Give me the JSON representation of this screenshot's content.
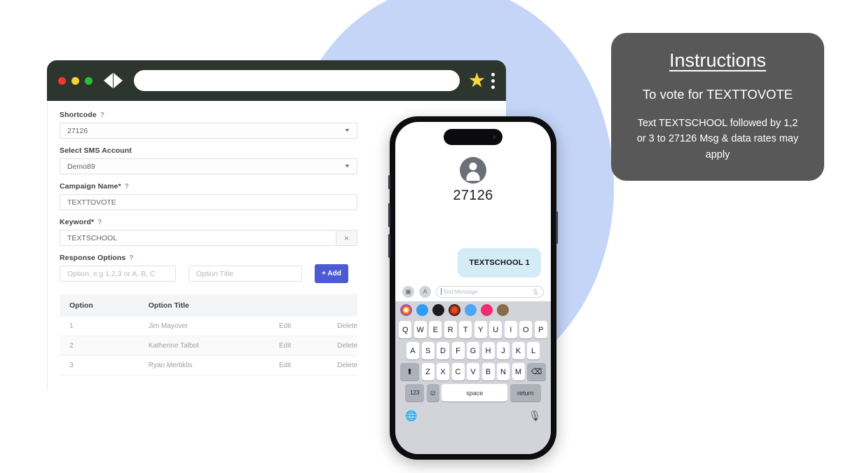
{
  "browser": {
    "traffic_lights": [
      "red",
      "yellow",
      "green"
    ],
    "url_value": "",
    "star_icon": "star-icon",
    "menu_icon": "kebab-menu-icon",
    "back_icon": "back-arrow-icon",
    "forward_icon": "forward-arrow-icon"
  },
  "form": {
    "shortcode": {
      "label": "Shortcode",
      "help": "?",
      "value": "27126"
    },
    "sms_account": {
      "label": "Select SMS Account",
      "value": "Demo89"
    },
    "campaign_name": {
      "label": "Campaign Name*",
      "help": "?",
      "value": "TEXTTOVOTE"
    },
    "keyword": {
      "label": "Keyword*",
      "help": "?",
      "value": "TEXTSCHOOL",
      "clear_icon": "×"
    },
    "response_options": {
      "label": "Response Options",
      "help": "?",
      "option_placeholder": "Option, e.g 1,2,3 or A, B, C",
      "option_value": "",
      "title_placeholder": "Option Title",
      "title_value": "",
      "add_label": "+ Add"
    },
    "table": {
      "headers": [
        "Option",
        "Option Title",
        "",
        ""
      ],
      "rows": [
        {
          "option": "1",
          "title": "Jim Mayover",
          "edit": "Edit",
          "delete": "Delete"
        },
        {
          "option": "2",
          "title": "Katherine Talbot",
          "edit": "Edit",
          "delete": "Delete"
        },
        {
          "option": "3",
          "title": "Ryan Mertiklis",
          "edit": "Edit",
          "delete": "Delete"
        }
      ]
    }
  },
  "phone": {
    "contact_name": "27126",
    "avatar_icon": "person-avatar-icon",
    "message_bubble": "TEXTSCHOOL 1",
    "compose": {
      "camera_icon": "camera-icon",
      "appstore_icon": "app-store-icon",
      "placeholder": "Text Message",
      "mic_icon": "microphone-icon"
    },
    "keyboard": {
      "row1": [
        "Q",
        "W",
        "E",
        "R",
        "T",
        "Y",
        "U",
        "I",
        "O",
        "P"
      ],
      "row2": [
        "A",
        "S",
        "D",
        "F",
        "G",
        "H",
        "J",
        "K",
        "L"
      ],
      "row3": [
        "Z",
        "X",
        "C",
        "V",
        "B",
        "N",
        "M"
      ],
      "shift_icon": "shift-icon",
      "backspace_icon": "backspace-icon",
      "numbers_key": "123",
      "emoji_icon": "emoji-icon",
      "space_key": "space",
      "return_key": "return",
      "globe_icon": "globe-icon",
      "dictation_icon": "microphone-icon"
    }
  },
  "instructions": {
    "title": "Instructions",
    "subtitle": "To vote for TEXTTOVOTE",
    "body": "Text TEXTSCHOOL followed by  1,2 or 3 to 27126 Msg & data rates may apply"
  },
  "colors": {
    "blob": "#c4d5f8",
    "browser_chrome": "#2d352f",
    "add_button": "#4c5bd4",
    "bubble": "#d4ecf6",
    "instructions_card": "#585858",
    "star": "#f8d93b"
  }
}
